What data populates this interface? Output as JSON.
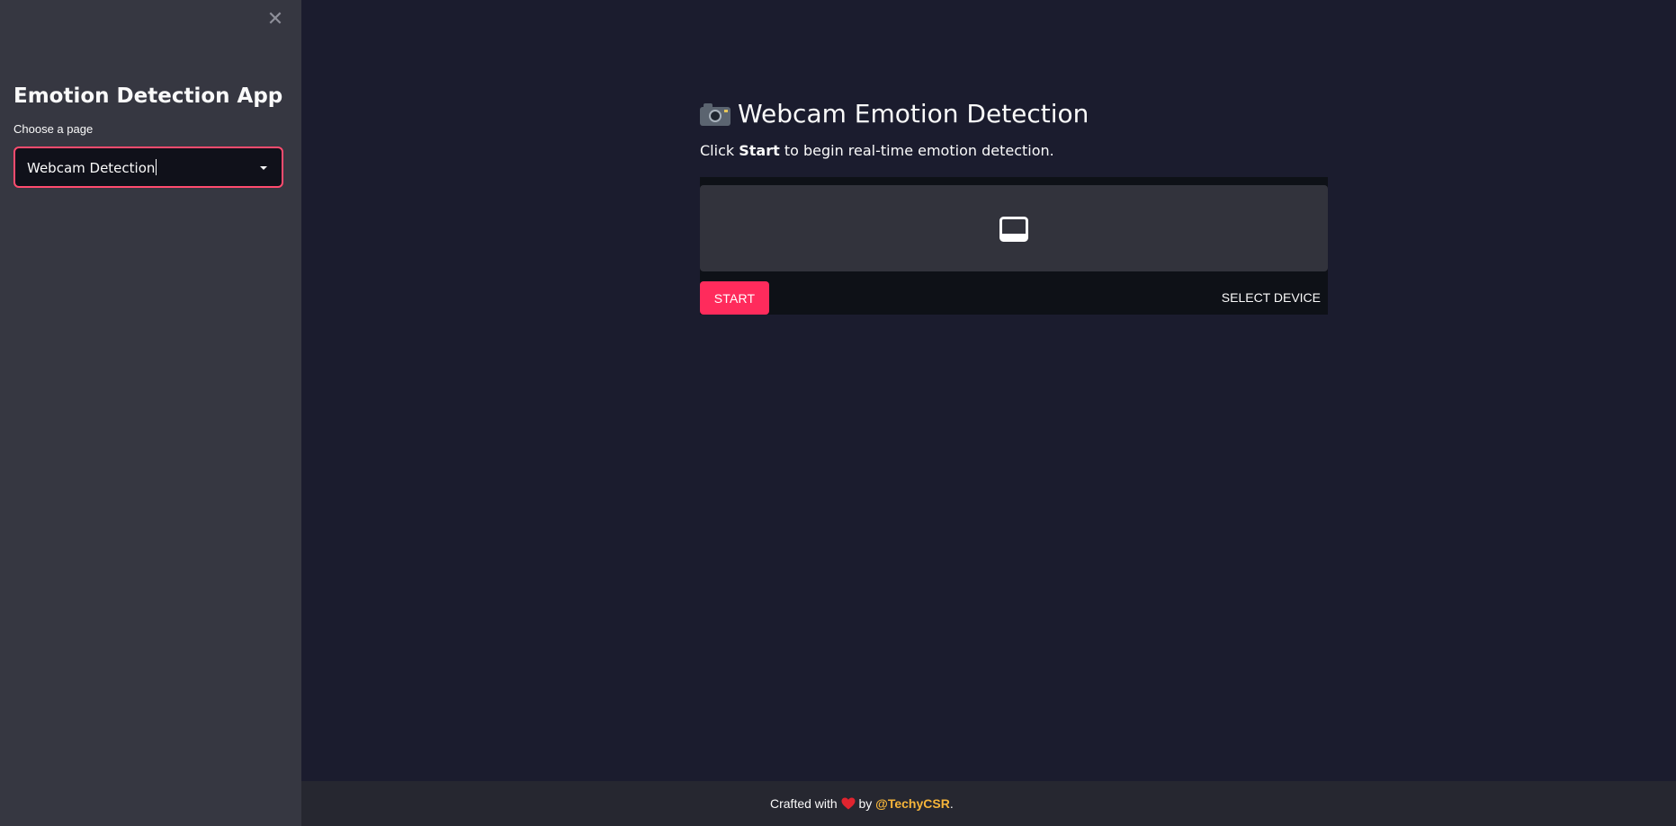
{
  "sidebar": {
    "close_icon": "close-icon",
    "close_glyph": "✕",
    "title": "Emotion Detection App",
    "select_label": "Choose a page",
    "select_value": "Webcam Detection"
  },
  "main": {
    "title_icon": "camera-icon",
    "title": "Webcam Emotion Detection",
    "desc_prefix": "Click ",
    "desc_bold": "Start",
    "desc_suffix": " to begin real-time emotion detection.",
    "webrtc": {
      "video_icon": "video-placeholder-icon",
      "start_label": "Start",
      "device_label": "Select Device"
    }
  },
  "footer": {
    "prefix": "Crafted with ",
    "heart_icon": "heart-icon",
    "middle": " by ",
    "link_text": "@TechyCSR",
    "suffix": "."
  },
  "colors": {
    "accent": "#ff2b5c",
    "link": "#f5b43a",
    "sidebar_bg": "#363741",
    "main_bg": "#1b1c2e"
  }
}
